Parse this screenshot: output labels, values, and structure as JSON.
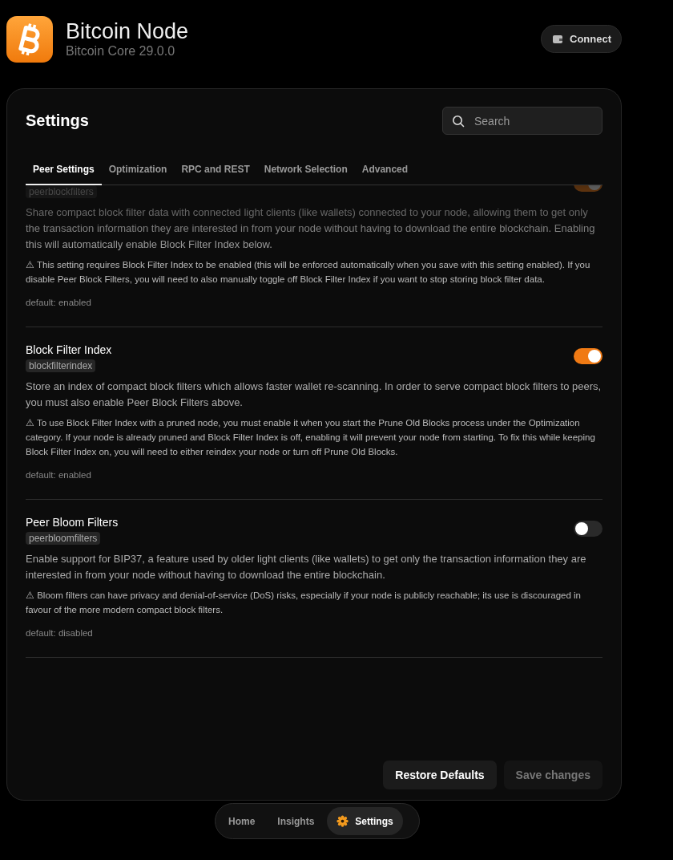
{
  "app": {
    "title": "Bitcoin Node",
    "subtitle": "Bitcoin Core 29.0.0",
    "connect_button": "Connect"
  },
  "settings": {
    "title": "Settings",
    "search": {
      "placeholder": "Search"
    },
    "tabs": [
      {
        "label": "Peer Settings",
        "selected": true
      },
      {
        "label": "Optimization",
        "selected": false
      },
      {
        "label": "RPC and REST",
        "selected": false
      },
      {
        "label": "Network Selection",
        "selected": false
      },
      {
        "label": "Advanced",
        "selected": false
      }
    ],
    "items": [
      {
        "tag": "peerblockfilters",
        "on": true,
        "description": "Share compact block filter data with connected light clients (like wallets) connected to your node, allowing them to get only the transaction information they are interested in from your node without having to download the entire blockchain. Enabling this will automatically enable Block Filter Index below.",
        "warning": "⚠ This setting requires Block Filter Index to be enabled (this will be enforced automatically when you save with this setting enabled). If you disable Peer Block Filters, you will need to also manually toggle off Block Filter Index if you want to stop storing block filter data.",
        "default": "default: enabled"
      },
      {
        "title": "Block Filter Index",
        "tag": "blockfilterindex",
        "on": true,
        "description": "Store an index of compact block filters which allows faster wallet re-scanning. In order to serve compact block filters to peers, you must also enable Peer Block Filters above.",
        "warning": "⚠ To use Block Filter Index with a pruned node, you must enable it when you start the Prune Old Blocks process under the Optimization category. If your node is already pruned and Block Filter Index is off, enabling it will prevent your node from starting. To fix this while keeping Block Filter Index on, you will need to either reindex your node or turn off Prune Old Blocks.",
        "default": "default: enabled"
      },
      {
        "title": "Peer Bloom Filters",
        "tag": "peerbloomfilters",
        "on": false,
        "description": "Enable support for BIP37, a feature used by older light clients (like wallets) to get only the transaction information they are interested in from your node without having to download the entire blockchain.",
        "warning": "⚠ Bloom filters can have privacy and denial-of-service (DoS) risks, especially if your node is publicly reachable; its use is discouraged in favour of the more modern compact block filters.",
        "default": "default: disabled"
      }
    ],
    "buttons": {
      "restore": "Restore Defaults",
      "save": {
        "label": "Save changes",
        "disabled": true
      }
    }
  },
  "nav": [
    {
      "label": "Home",
      "selected": false
    },
    {
      "label": "Insights",
      "selected": false
    },
    {
      "label": "Settings",
      "selected": true
    }
  ]
}
